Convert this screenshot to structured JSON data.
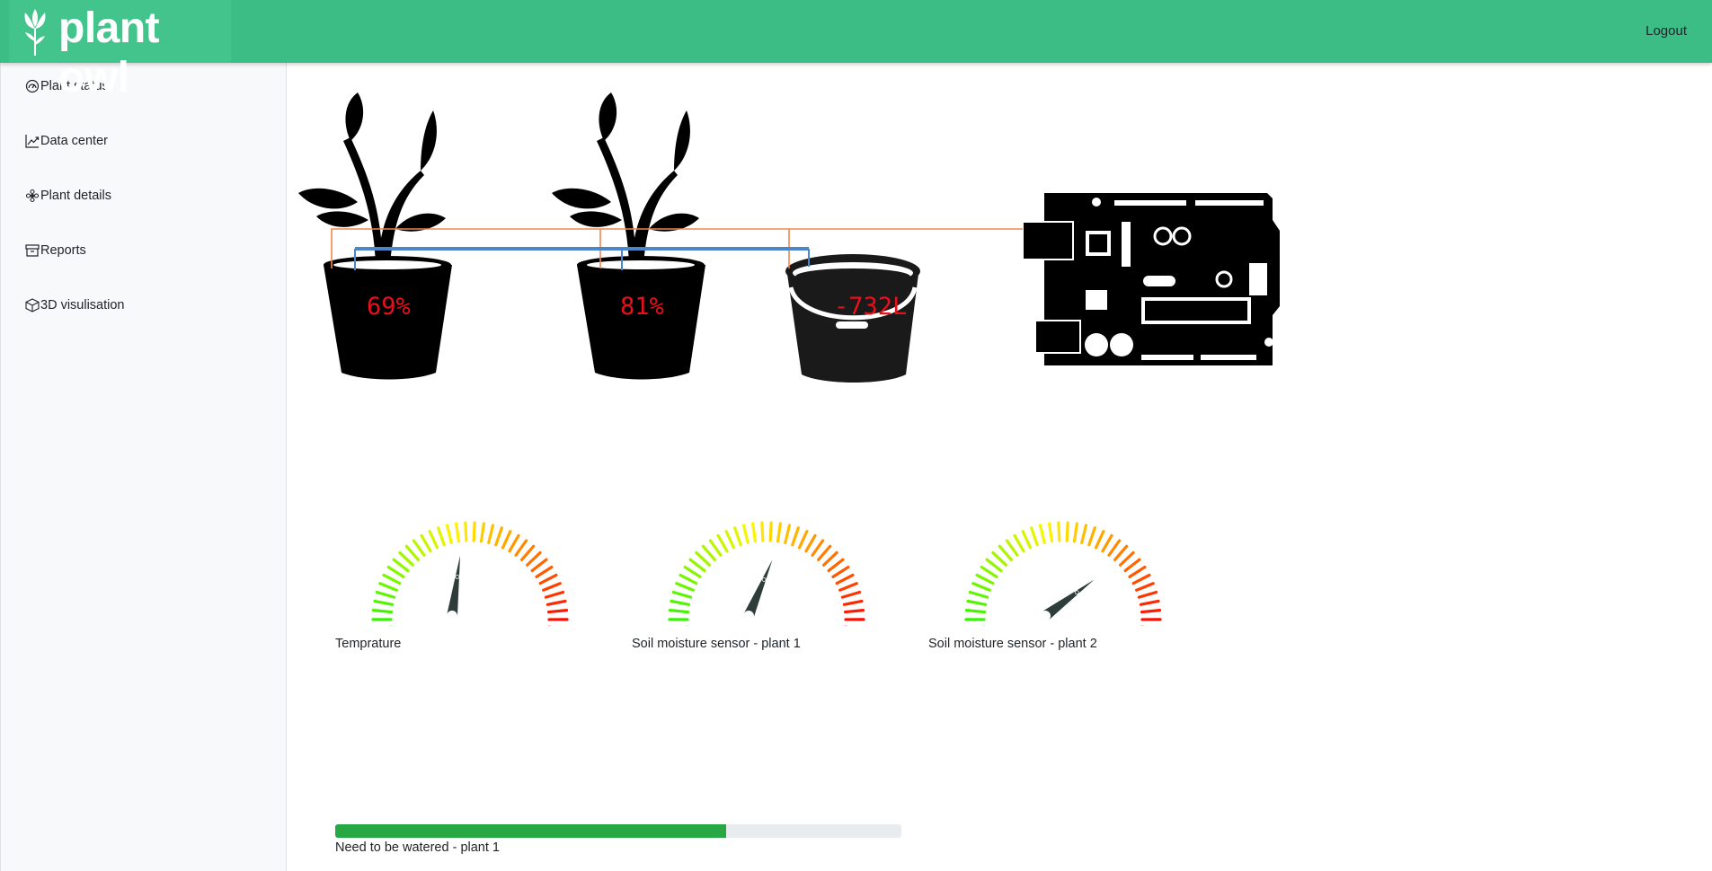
{
  "header": {
    "brand": "plant owl",
    "logout_label": "Logout",
    "color": "#3dbd86"
  },
  "sidebar": {
    "items": [
      {
        "label": "Plant status",
        "icon": "speedometer-icon"
      },
      {
        "label": "Data center",
        "icon": "graph-up-icon"
      },
      {
        "label": "Plant details",
        "icon": "flower-icon"
      },
      {
        "label": "Reports",
        "icon": "archive-icon"
      },
      {
        "label": "3D visulisation",
        "icon": "box-icon"
      }
    ]
  },
  "scene": {
    "plant1_moisture": "69%",
    "plant2_moisture": "81%",
    "tank_level": "-732L",
    "value_color": "#e8101a",
    "sensor_wire_color": "#f0884e",
    "water_pipe_color": "#4a86c8"
  },
  "gauges": [
    {
      "label": "Temprature",
      "value": 0.54
    },
    {
      "label": "Soil moisture sensor - plant 1",
      "value": 0.62
    },
    {
      "label": "Soil moisture sensor - plant 2",
      "value": 0.78
    }
  ],
  "progress": {
    "label": "Need to be watered - plant 1",
    "value_percent": 69,
    "color": "#28a745"
  }
}
